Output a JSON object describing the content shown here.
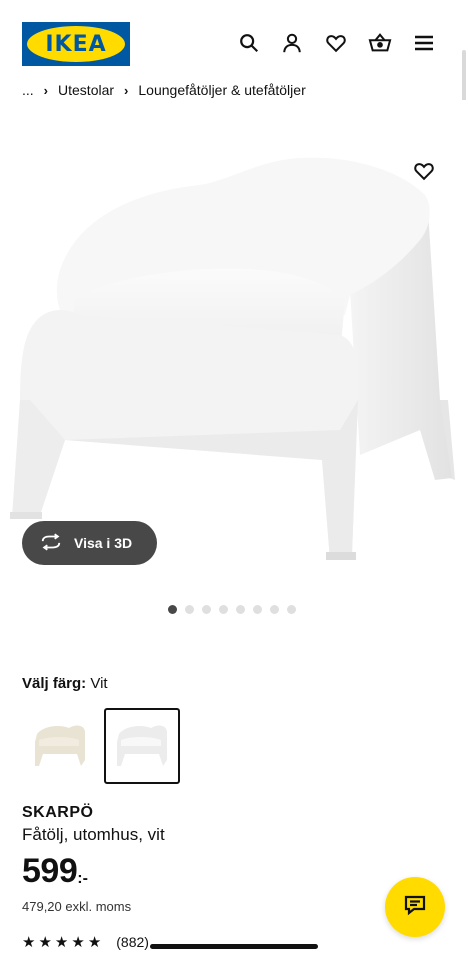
{
  "header": {
    "logo_text": "IKEA",
    "icons": [
      "search-icon",
      "account-icon",
      "heart-icon",
      "cart-icon",
      "menu-icon"
    ]
  },
  "breadcrumb": {
    "ellipsis": "...",
    "items": [
      "Utestolar",
      "Loungefåtöljer & utefåtöljer"
    ]
  },
  "gallery": {
    "view_3d_label": "Visa i 3D",
    "dot_count": 8,
    "active_dot": 0
  },
  "color": {
    "label": "Välj färg:",
    "value": "Vit",
    "swatches": [
      {
        "name": "beige",
        "color": "#e9e3d3",
        "selected": false
      },
      {
        "name": "white",
        "color": "#f6f6f6",
        "selected": true
      }
    ]
  },
  "product": {
    "name": "SKARPÖ",
    "description": "Fåtölj, utomhus, vit",
    "price": "599",
    "price_suffix": ":-",
    "price_excl": "479,20 exkl. moms",
    "rating_stars": 5,
    "rating_count": "(882)"
  },
  "colors": {
    "ikea_blue": "#0058a3",
    "ikea_yellow": "#ffdb00",
    "button_dark": "#484848"
  }
}
